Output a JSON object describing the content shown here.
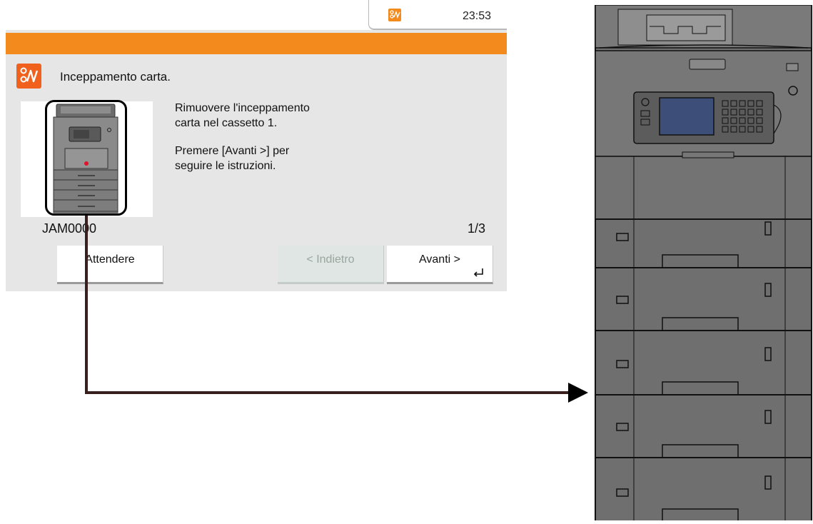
{
  "status_bar": {
    "time": "23:53",
    "alert_icon": "paper-jam-icon"
  },
  "colors": {
    "accent_orange": "#f28a1d",
    "alert_icon": "#f0611d",
    "screen_bg": "#e6e6e6"
  },
  "dialog": {
    "title": "Inceppamento carta.",
    "title_icon": "paper-jam-icon",
    "message_line_1": "Rimuovere l'inceppamento",
    "message_line_2": "carta nel cassetto 1.",
    "message_line_3": "Premere [Avanti >] per",
    "message_line_4": "seguire le istruzioni.",
    "jam_code": "JAM0000",
    "page_indicator": "1/3"
  },
  "buttons": {
    "wait_label": "Attendere",
    "back_label": "< Indietro",
    "next_label": "Avanti >"
  }
}
